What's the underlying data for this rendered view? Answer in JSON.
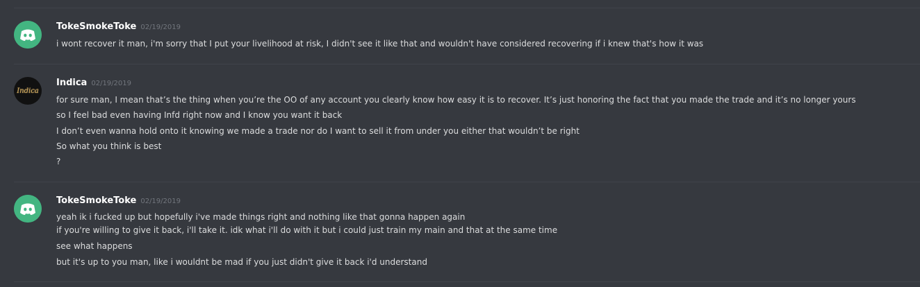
{
  "messages": [
    {
      "username": "TokeSmokeToke",
      "timestamp": "02/19/2019",
      "avatar": "discord-default-icon",
      "lines": [
        "i wont recover it man, i'm sorry that I put your livelihood at risk, I didn't see it like that and wouldn't have considered recovering if i knew that's how it was"
      ]
    },
    {
      "username": "Indica",
      "timestamp": "02/19/2019",
      "avatar": "indica-avatar",
      "avatar_text": "Indica",
      "lines": [
        "for sure man, I mean that’s the thing when you’re the OO of any account you clearly know how easy it is to recover. It’s just honoring the fact that you made the trade and it’s no longer yours",
        "so I feel bad even having Infd right now and I know you want it back",
        "I don’t even wanna hold onto it knowing we made a trade nor do I want to sell it from under you either that wouldn’t be right",
        "So what you think is best",
        "?"
      ]
    },
    {
      "username": "TokeSmokeToke",
      "timestamp": "02/19/2019",
      "avatar": "discord-default-icon",
      "lines": [
        "yeah ik i fucked up but hopefully i've made things right and nothing like that gonna happen again",
        "if you're willing to give it back, i'll take it. idk what i'll do with it but i could just train my main and that at the same time",
        "see what happens",
        "but it's up to you man, like i wouldnt be mad if you just didn't give it back i'd understand"
      ]
    }
  ],
  "colors": {
    "background": "#36393f",
    "username": "#ffffff",
    "timestamp": "#72767d",
    "text": "#dcddde",
    "discord_green": "#43b581"
  }
}
